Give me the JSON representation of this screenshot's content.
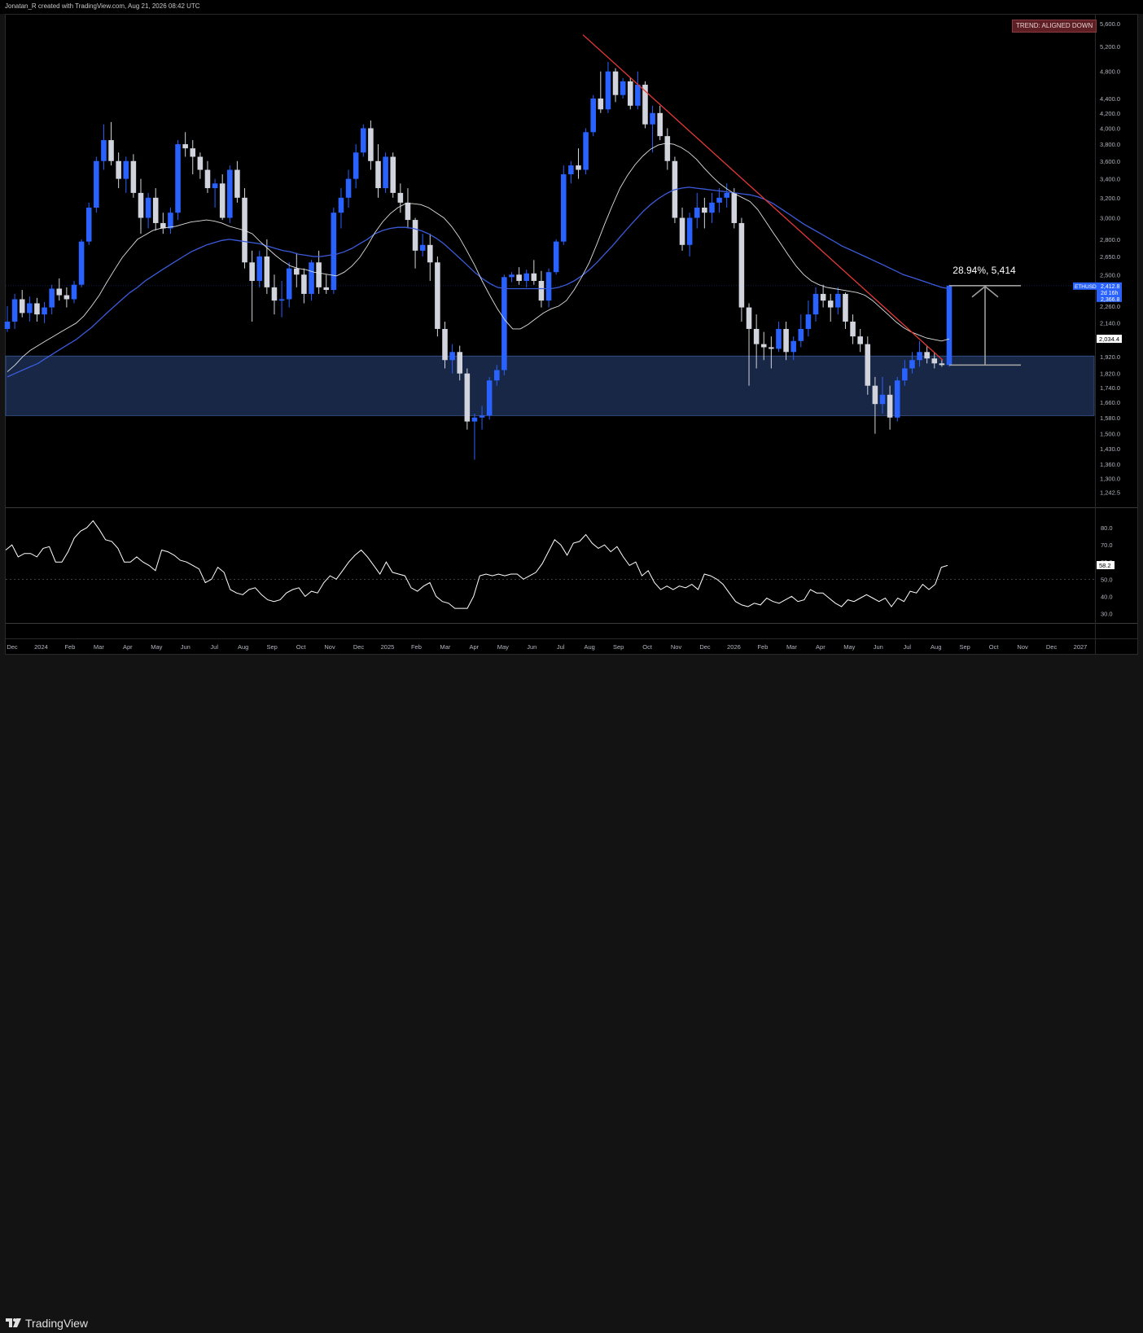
{
  "header": {
    "attribution": "Jonatan_R created with TradingView.com, Aug 21, 2026 08:42 UTC"
  },
  "badge": {
    "trend_label": "TREND: ALIGNED DOWN"
  },
  "footer": {
    "brand": "TradingView"
  },
  "colors": {
    "bull": "#2962ff",
    "bear": "#d1d4dc",
    "ma_slow": "#3b5bdb",
    "ma_fast": "#e0e0e0",
    "trendline": "#e53935",
    "zone_fill": "#1a2a4a",
    "rsi": "#ffffff",
    "badge_bg": "#5e1f24"
  },
  "chart_data": [
    {
      "type": "candlestick",
      "symbol": "ETHUSD",
      "interval": "1W",
      "scale": "log",
      "ylim": [
        1200,
        5700
      ],
      "price_ticks": [
        "5,600.0",
        "5,200.0",
        "4,800.0",
        "4,400.0",
        "4,200.0",
        "4,000.0",
        "3,800.0",
        "3,600.0",
        "3,400.0",
        "3,200.0",
        "3,000.0",
        "2,800.0",
        "2,650.0",
        "2,500.0",
        "2,380.0",
        "2,260.0",
        "2,140.0",
        "2,034.4",
        "1,920.0",
        "1,820.0",
        "1,740.0",
        "1,660.0",
        "1,580.0",
        "1,500.0",
        "1,430.0",
        "1,360.0",
        "1,300.0",
        "1,242.5"
      ],
      "x_ticks": [
        "Dec",
        "2024",
        "Feb",
        "Mar",
        "Apr",
        "May",
        "Jun",
        "Jul",
        "Aug",
        "Sep",
        "Oct",
        "Nov",
        "Dec",
        "2025",
        "Feb",
        "Mar",
        "Apr",
        "May",
        "Jun",
        "Jul",
        "Aug",
        "Sep",
        "Oct",
        "Nov",
        "Dec",
        "2026",
        "Feb",
        "Mar",
        "Apr",
        "May",
        "Jun",
        "Jul",
        "Aug",
        "Sep",
        "Oct",
        "Nov",
        "Dec",
        "2027"
      ],
      "candles": [
        [
          2100,
          2260,
          2080,
          2150
        ],
        [
          2150,
          2350,
          2100,
          2310
        ],
        [
          2310,
          2380,
          2180,
          2210
        ],
        [
          2210,
          2330,
          2150,
          2280
        ],
        [
          2280,
          2320,
          2150,
          2200
        ],
        [
          2200,
          2290,
          2140,
          2250
        ],
        [
          2250,
          2420,
          2200,
          2390
        ],
        [
          2390,
          2470,
          2300,
          2340
        ],
        [
          2340,
          2400,
          2250,
          2310
        ],
        [
          2310,
          2450,
          2280,
          2420
        ],
        [
          2420,
          2800,
          2400,
          2780
        ],
        [
          2780,
          3150,
          2750,
          3100
        ],
        [
          3100,
          3650,
          3050,
          3600
        ],
        [
          3600,
          4050,
          3500,
          3850
        ],
        [
          3850,
          4080,
          3550,
          3600
        ],
        [
          3600,
          3700,
          3300,
          3400
        ],
        [
          3400,
          3650,
          3250,
          3600
        ],
        [
          3600,
          3680,
          3200,
          3250
        ],
        [
          3250,
          3400,
          2850,
          3000
        ],
        [
          3000,
          3250,
          2900,
          3200
        ],
        [
          3200,
          3300,
          2880,
          2950
        ],
        [
          2950,
          3050,
          2850,
          2900
        ],
        [
          2900,
          3100,
          2850,
          3050
        ],
        [
          3050,
          3850,
          2980,
          3800
        ],
        [
          3800,
          3950,
          3650,
          3750
        ],
        [
          3750,
          3850,
          3450,
          3650
        ],
        [
          3650,
          3700,
          3400,
          3500
        ],
        [
          3500,
          3600,
          3250,
          3300
        ],
        [
          3300,
          3400,
          3100,
          3350
        ],
        [
          3350,
          3450,
          2980,
          3000
        ],
        [
          3000,
          3550,
          2950,
          3500
        ],
        [
          3500,
          3600,
          3150,
          3200
        ],
        [
          3200,
          3300,
          2550,
          2600
        ],
        [
          2600,
          2700,
          2150,
          2450
        ],
        [
          2450,
          2700,
          2400,
          2650
        ],
        [
          2650,
          2800,
          2350,
          2400
        ],
        [
          2400,
          2500,
          2200,
          2300
        ],
        [
          2300,
          2450,
          2180,
          2310
        ],
        [
          2310,
          2600,
          2250,
          2550
        ],
        [
          2550,
          2680,
          2400,
          2500
        ],
        [
          2500,
          2550,
          2280,
          2350
        ],
        [
          2350,
          2620,
          2300,
          2600
        ],
        [
          2600,
          2700,
          2350,
          2400
        ],
        [
          2400,
          2500,
          2350,
          2380
        ],
        [
          2380,
          3100,
          2350,
          3050
        ],
        [
          3050,
          3300,
          2900,
          3200
        ],
        [
          3200,
          3500,
          3100,
          3400
        ],
        [
          3400,
          3800,
          3300,
          3700
        ],
        [
          3700,
          4050,
          3650,
          4000
        ],
        [
          4000,
          4100,
          3500,
          3600
        ],
        [
          3600,
          3800,
          3200,
          3300
        ],
        [
          3300,
          3700,
          3250,
          3650
        ],
        [
          3650,
          3700,
          3200,
          3250
        ],
        [
          3250,
          3350,
          3050,
          3150
        ],
        [
          3150,
          3300,
          2900,
          2980
        ],
        [
          2980,
          3000,
          2550,
          2700
        ],
        [
          2700,
          2850,
          2650,
          2750
        ],
        [
          2750,
          2850,
          2450,
          2600
        ],
        [
          2600,
          2650,
          2050,
          2100
        ],
        [
          2100,
          2150,
          1850,
          1900
        ],
        [
          1900,
          2000,
          1820,
          1950
        ],
        [
          1950,
          1990,
          1780,
          1820
        ],
        [
          1820,
          1850,
          1520,
          1560
        ],
        [
          1560,
          1600,
          1380,
          1580
        ],
        [
          1580,
          1640,
          1520,
          1590
        ],
        [
          1590,
          1800,
          1570,
          1780
        ],
        [
          1780,
          1870,
          1750,
          1840
        ],
        [
          1840,
          2500,
          1810,
          2480
        ],
        [
          2480,
          2520,
          2440,
          2500
        ],
        [
          2500,
          2560,
          2420,
          2450
        ],
        [
          2450,
          2540,
          2400,
          2510
        ],
        [
          2510,
          2620,
          2420,
          2450
        ],
        [
          2450,
          2530,
          2250,
          2300
        ],
        [
          2300,
          2550,
          2250,
          2520
        ],
        [
          2520,
          2800,
          2500,
          2780
        ],
        [
          2780,
          3550,
          2750,
          3450
        ],
        [
          3450,
          3600,
          3350,
          3550
        ],
        [
          3550,
          3750,
          3400,
          3500
        ],
        [
          3500,
          4000,
          3450,
          3950
        ],
        [
          3950,
          4450,
          3900,
          4400
        ],
        [
          4400,
          4800,
          4200,
          4250
        ],
        [
          4250,
          4950,
          4200,
          4800
        ],
        [
          4800,
          4850,
          4350,
          4450
        ],
        [
          4450,
          4700,
          4400,
          4650
        ],
        [
          4650,
          4700,
          4250,
          4300
        ],
        [
          4300,
          4800,
          4250,
          4600
        ],
        [
          4600,
          4650,
          4000,
          4050
        ],
        [
          4050,
          4300,
          3700,
          4200
        ],
        [
          4200,
          4300,
          3850,
          3900
        ],
        [
          3900,
          4000,
          3500,
          3600
        ],
        [
          3600,
          3650,
          2950,
          3000
        ],
        [
          3000,
          3100,
          2700,
          2750
        ],
        [
          2750,
          3050,
          2650,
          3000
        ],
        [
          3000,
          3250,
          2900,
          3100
        ],
        [
          3100,
          3200,
          2900,
          3050
        ],
        [
          3050,
          3250,
          2950,
          3150
        ],
        [
          3150,
          3300,
          3050,
          3200
        ],
        [
          3200,
          3350,
          3100,
          3250
        ],
        [
          3250,
          3300,
          2900,
          2950
        ],
        [
          2950,
          3000,
          2150,
          2250
        ],
        [
          2250,
          2280,
          1750,
          2100
        ],
        [
          2100,
          2200,
          1850,
          2000
        ],
        [
          2000,
          2080,
          1900,
          1980
        ],
        [
          1980,
          2050,
          1850,
          1970
        ],
        [
          1970,
          2150,
          1950,
          2100
        ],
        [
          2100,
          2150,
          1900,
          1950
        ],
        [
          1950,
          2050,
          1900,
          2020
        ],
        [
          2020,
          2200,
          1980,
          2100
        ],
        [
          2100,
          2300,
          2050,
          2200
        ],
        [
          2200,
          2400,
          2150,
          2350
        ],
        [
          2350,
          2420,
          2250,
          2300
        ],
        [
          2300,
          2350,
          2150,
          2250
        ],
        [
          2250,
          2400,
          2200,
          2350
        ],
        [
          2350,
          2360,
          2100,
          2150
        ],
        [
          2150,
          2200,
          2000,
          2050
        ],
        [
          2050,
          2100,
          1950,
          2000
        ],
        [
          2000,
          2050,
          1700,
          1750
        ],
        [
          1750,
          1800,
          1500,
          1650
        ],
        [
          1650,
          1800,
          1600,
          1700
        ],
        [
          1700,
          1750,
          1520,
          1580
        ],
        [
          1580,
          1800,
          1560,
          1780
        ],
        [
          1780,
          1900,
          1750,
          1850
        ],
        [
          1850,
          1950,
          1820,
          1900
        ],
        [
          1900,
          2020,
          1860,
          1950
        ],
        [
          1950,
          1990,
          1880,
          1910
        ],
        [
          1910,
          1950,
          1850,
          1880
        ],
        [
          1880,
          1900,
          1860,
          1870
        ],
        [
          1870,
          2420,
          1860,
          2413
        ]
      ],
      "ma_fast": [
        1830,
        1870,
        1920,
        1960,
        1990,
        2020,
        2050,
        2080,
        2110,
        2140,
        2190,
        2260,
        2340,
        2440,
        2540,
        2640,
        2720,
        2800,
        2840,
        2880,
        2900,
        2910,
        2920,
        2940,
        2960,
        2970,
        2980,
        2970,
        2950,
        2920,
        2900,
        2880,
        2850,
        2780,
        2720,
        2660,
        2610,
        2570,
        2550,
        2540,
        2520,
        2510,
        2500,
        2490,
        2520,
        2570,
        2640,
        2740,
        2860,
        2960,
        3040,
        3100,
        3140,
        3140,
        3130,
        3100,
        3050,
        3000,
        2920,
        2820,
        2700,
        2580,
        2450,
        2340,
        2240,
        2160,
        2100,
        2100,
        2130,
        2170,
        2210,
        2240,
        2260,
        2300,
        2380,
        2480,
        2600,
        2760,
        2940,
        3120,
        3300,
        3440,
        3560,
        3660,
        3740,
        3790,
        3810,
        3800,
        3760,
        3700,
        3620,
        3520,
        3430,
        3350,
        3290,
        3240,
        3200,
        3160,
        3080,
        2970,
        2860,
        2760,
        2660,
        2570,
        2500,
        2450,
        2420,
        2400,
        2390,
        2380,
        2370,
        2360,
        2340,
        2300,
        2250,
        2200,
        2150,
        2110,
        2080,
        2060,
        2040,
        2030,
        2020,
        2034
      ],
      "ma_slow": [
        1800,
        1820,
        1840,
        1860,
        1880,
        1910,
        1940,
        1970,
        2000,
        2030,
        2070,
        2110,
        2160,
        2210,
        2260,
        2310,
        2360,
        2400,
        2450,
        2490,
        2530,
        2570,
        2610,
        2650,
        2690,
        2720,
        2750,
        2770,
        2790,
        2800,
        2790,
        2780,
        2770,
        2760,
        2740,
        2720,
        2700,
        2690,
        2670,
        2660,
        2650,
        2650,
        2660,
        2670,
        2690,
        2720,
        2760,
        2800,
        2850,
        2880,
        2900,
        2910,
        2910,
        2900,
        2880,
        2850,
        2810,
        2760,
        2700,
        2640,
        2580,
        2520,
        2470,
        2430,
        2400,
        2390,
        2390,
        2390,
        2390,
        2390,
        2390,
        2390,
        2400,
        2420,
        2450,
        2490,
        2540,
        2600,
        2670,
        2740,
        2820,
        2900,
        2980,
        3060,
        3130,
        3190,
        3240,
        3280,
        3300,
        3310,
        3300,
        3290,
        3280,
        3270,
        3260,
        3250,
        3240,
        3230,
        3210,
        3180,
        3140,
        3090,
        3040,
        2990,
        2940,
        2900,
        2860,
        2820,
        2780,
        2740,
        2710,
        2680,
        2650,
        2620,
        2590,
        2560,
        2530,
        2500,
        2480,
        2460,
        2440,
        2420,
        2400,
        2390
      ],
      "trendline": {
        "from": {
          "date": "Aug 2025",
          "price": 5400
        },
        "to": {
          "date": "Aug 2026",
          "price": 1900
        }
      },
      "support_zone": {
        "top": 1925,
        "bottom": 1590
      },
      "measure": {
        "label": "28.94%, 5,414",
        "from_price": 1870,
        "to_price": 2413
      },
      "price_label": {
        "symbol": "ETHUSD",
        "price": "2,412.8",
        "countdown": "2d 16h",
        "ma_value": "2,366.8"
      },
      "ma_tag": "2,034.4"
    },
    {
      "type": "line",
      "name": "RSI",
      "ylim": [
        25,
        90
      ],
      "y_ticks": [
        "80.0",
        "70.0",
        "60.0",
        "50.0",
        "40.0",
        "30.0"
      ],
      "midline": 50,
      "values": [
        67,
        70,
        63,
        65,
        65,
        63,
        68,
        69,
        60,
        60,
        66,
        74,
        78,
        80,
        84,
        79,
        73,
        72,
        68,
        60,
        60,
        63,
        60,
        58,
        55,
        67,
        66,
        64,
        61,
        60,
        58,
        56,
        48,
        50,
        57,
        54,
        44,
        42,
        41,
        44,
        45,
        41,
        38,
        37,
        38,
        42,
        44,
        45,
        40,
        43,
        42,
        48,
        52,
        50,
        55,
        60,
        64,
        67,
        63,
        58,
        53,
        60,
        54,
        53,
        52,
        45,
        43,
        46,
        48,
        40,
        37,
        36,
        33,
        33,
        33,
        40,
        52,
        53,
        52,
        53,
        52,
        53,
        53,
        50,
        52,
        54,
        59,
        66,
        73,
        70,
        64,
        71,
        72,
        76,
        71,
        68,
        70,
        66,
        69,
        63,
        58,
        60,
        52,
        55,
        48,
        44,
        46,
        44,
        46,
        45,
        47,
        44,
        53,
        52,
        50,
        47,
        42,
        37,
        35,
        34,
        36,
        35,
        39,
        37,
        36,
        38,
        40,
        37,
        38,
        44,
        42,
        42,
        39,
        36,
        34,
        38,
        37,
        39,
        41,
        39,
        37,
        39,
        34,
        39,
        37,
        43,
        42,
        47,
        44,
        47,
        57,
        58
      ],
      "last_value": "58.2"
    }
  ]
}
